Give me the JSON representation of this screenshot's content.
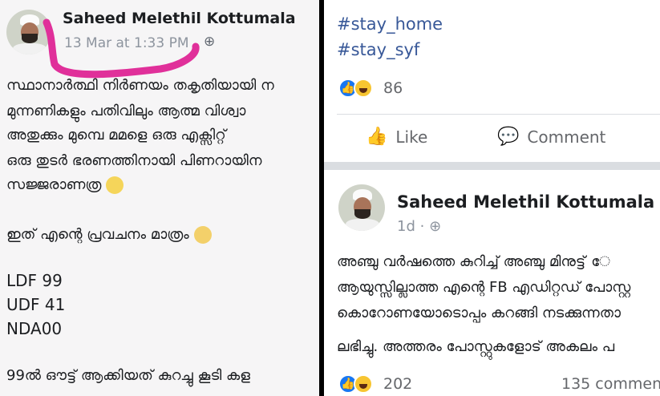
{
  "left_post": {
    "author": "Saheed Melethil Kottumala",
    "timestamp": "13 Mar at 1:33 PM",
    "privacy_icon": "globe-icon",
    "body_lines": [
      "സ്ഥാനാർത്ഥി നിർണയം തകൃതിയായി ന",
      "മുന്നണികളും പതിവിലും ആത്മ വിശ്വാ",
      "അതുക്കും മുമ്പെ മമളെ ഒരു എക്സിറ്റ്",
      "ഒരു തുടർ ഭരണത്തിനായി പിണറായിന",
      "സജ്ജരാണത്ര"
    ],
    "prediction_line": "ഇത് എന്റെ പ്രവചനം മാത്രം",
    "results": [
      "LDF 99",
      "UDF 41",
      "NDA00"
    ],
    "footer_line": "99ൽ ഔട്ട് ആക്കിയത് കുറച്ചു കൂടി കള",
    "highlight_color": "#e0309a"
  },
  "right_top": {
    "hashtags": [
      "#stay_home",
      "#stay_syf"
    ],
    "reaction_count": "86",
    "like_label": "Like",
    "comment_label": "Comment"
  },
  "right_post": {
    "author": "Saheed Melethil Kottumala",
    "timestamp": "1d",
    "privacy_icon": "globe-icon",
    "body_lines": [
      "അഞ്ചു വർഷത്തെ കുറിച്ച് അഞ്ചു മിനുട്ട് േ",
      "ആയുസ്സില്ലാത്ത എന്റെ FB എഡിറ്റഡ് പോസ്റ്റ",
      "കൊറോണയോടൊപ്പം കറങ്ങി നടക്കുന്നതാ",
      "ലഭിച്ചു. അത്തരം പോസ്റ്റുകളോട് അകലം പ"
    ],
    "reaction_count": "202",
    "comment_count": "135 commen"
  }
}
